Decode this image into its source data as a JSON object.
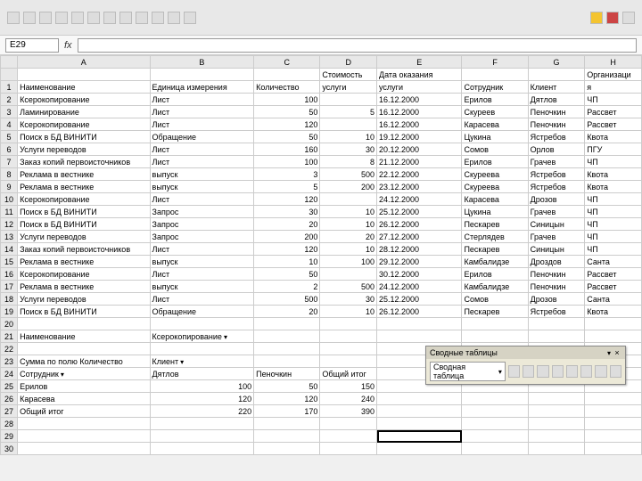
{
  "namebox": "E29",
  "columns": [
    "",
    "A",
    "B",
    "C",
    "D",
    "E",
    "F",
    "G",
    "H"
  ],
  "headerRow1": {
    "D": "Стоимость",
    "E": "Дата оказания",
    "H": "Организаци"
  },
  "headerRow2": {
    "A": "Наименование",
    "B": "Единица измерения",
    "C": "Количество",
    "D": "услуги",
    "E": "услуги",
    "F": "Сотрудник",
    "G": "Клиент",
    "H": "я"
  },
  "rows": [
    {
      "n": 2,
      "A": "Ксерокопирование",
      "B": "Лист",
      "C": "100",
      "D": "",
      "E": "16.12.2000",
      "F": "Ерилов",
      "G": "Дятлов",
      "H": "ЧП"
    },
    {
      "n": 3,
      "A": "Ламинирование",
      "B": "Лист",
      "C": "50",
      "D": "5",
      "E": "16.12.2000",
      "F": "Скуреев",
      "G": "Пеночкин",
      "H": "Рассвет"
    },
    {
      "n": 4,
      "A": "Ксерокопирование",
      "B": "Лист",
      "C": "120",
      "D": "",
      "E": "16.12.2000",
      "F": "Карасева",
      "G": "Пеночкин",
      "H": "Рассвет"
    },
    {
      "n": 5,
      "A": "Поиск в БД ВИНИТИ",
      "B": "Обращение",
      "C": "50",
      "D": "10",
      "E": "19.12.2000",
      "F": "Цукина",
      "G": "Ястребов",
      "H": "Квота"
    },
    {
      "n": 6,
      "A": "Услуги переводов",
      "B": "Лист",
      "C": "160",
      "D": "30",
      "E": "20.12.2000",
      "F": "Сомов",
      "G": "Орлов",
      "H": "ПГУ"
    },
    {
      "n": 7,
      "A": "Заказ копий первоисточников",
      "B": "Лист",
      "C": "100",
      "D": "8",
      "E": "21.12.2000",
      "F": "Ерилов",
      "G": "Грачев",
      "H": "ЧП"
    },
    {
      "n": 8,
      "A": "Реклама в вестнике",
      "B": "выпуск",
      "C": "3",
      "D": "500",
      "E": "22.12.2000",
      "F": "Скуреева",
      "G": "Ястребов",
      "H": "Квота"
    },
    {
      "n": 9,
      "A": "Реклама в вестнике",
      "B": "выпуск",
      "C": "5",
      "D": "200",
      "E": "23.12.2000",
      "F": "Скуреева",
      "G": "Ястребов",
      "H": "Квота"
    },
    {
      "n": 10,
      "A": "Ксерокопирование",
      "B": "Лист",
      "C": "120",
      "D": "",
      "E": "24.12.2000",
      "F": "Карасева",
      "G": "Дрозов",
      "H": "ЧП"
    },
    {
      "n": 11,
      "A": "Поиск в БД ВИНИТИ",
      "B": "Запрос",
      "C": "30",
      "D": "10",
      "E": "25.12.2000",
      "F": "Цукина",
      "G": "Грачев",
      "H": "ЧП"
    },
    {
      "n": 12,
      "A": "Поиск в БД ВИНИТИ",
      "B": "Запрос",
      "C": "20",
      "D": "10",
      "E": "26.12.2000",
      "F": "Пескарев",
      "G": "Синицын",
      "H": "ЧП"
    },
    {
      "n": 13,
      "A": "Услуги переводов",
      "B": "Запрос",
      "C": "200",
      "D": "20",
      "E": "27.12.2000",
      "F": "Стерлядев",
      "G": "Грачев",
      "H": "ЧП"
    },
    {
      "n": 14,
      "A": "Заказ копий первоисточников",
      "B": "Лист",
      "C": "120",
      "D": "10",
      "E": "28.12.2000",
      "F": "Пескарев",
      "G": "Синицын",
      "H": "ЧП"
    },
    {
      "n": 15,
      "A": "Реклама в вестнике",
      "B": "выпуск",
      "C": "10",
      "D": "100",
      "E": "29.12.2000",
      "F": "Камбалидзе",
      "G": "Дроздов",
      "H": "Санта"
    },
    {
      "n": 16,
      "A": "Ксерокопирование",
      "B": "Лист",
      "C": "50",
      "D": "",
      "E": "30.12.2000",
      "F": "Ерилов",
      "G": "Пеночкин",
      "H": "Рассвет"
    },
    {
      "n": 17,
      "A": "Реклама в вестнике",
      "B": "выпуск",
      "C": "2",
      "D": "500",
      "E": "24.12.2000",
      "F": "Камбалидзе",
      "G": "Пеночкин",
      "H": "Рассвет"
    },
    {
      "n": 18,
      "A": "Услуги переводов",
      "B": "Лист",
      "C": "500",
      "D": "30",
      "E": "25.12.2000",
      "F": "Сомов",
      "G": "Дрозов",
      "H": "Санта"
    },
    {
      "n": 19,
      "A": "Поиск в БД ВИНИТИ",
      "B": "Обращение",
      "C": "20",
      "D": "10",
      "E": "26.12.2000",
      "F": "Пескарев",
      "G": "Ястребов",
      "H": "Квота"
    }
  ],
  "pivot": {
    "r21A": "Наименование",
    "r21B": "Ксерокопирование",
    "r23A": "Сумма по полю Количество",
    "r23B": "Клиент",
    "r24A": "Сотрудник",
    "r24B": "Дятлов",
    "r24C": "Пеночкин",
    "r24D": "Общий итог",
    "r25A": "Ерилов",
    "r25B": "100",
    "r25C": "50",
    "r25D": "150",
    "r26A": "Карасева",
    "r26B": "120",
    "r26C": "120",
    "r26D": "240",
    "r27A": "Общий итог",
    "r27B": "220",
    "r27C": "170",
    "r27D": "390"
  },
  "pivotToolbar": {
    "title": "Сводные таблицы",
    "dropdown": "Сводная таблица"
  }
}
